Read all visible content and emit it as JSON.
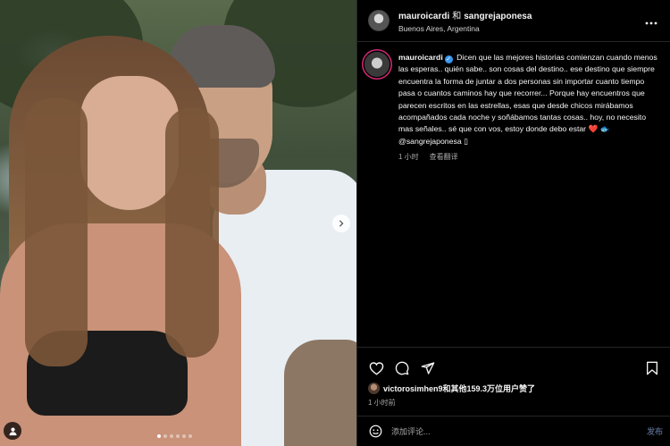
{
  "header": {
    "author": "mauroicardi",
    "conjunction": "和",
    "collaborator": "sangrejaponesa",
    "location": "Buenos Aires, Argentina",
    "more_icon": "more-horizontal-icon"
  },
  "caption": {
    "username": "mauroicardi",
    "verified_icon": "verified-badge-icon",
    "text": "Dicen que las mejores historias comienzan cuando menos las esperas.. quién sabe.. son cosas del destino.. ese destino que siempre encuentra la forma de juntar a dos personas sin importar cuanto tiempo pasa o cuantos caminos hay que recorrer... Porque hay encuentros que parecen escritos en las estrellas, esas que desde chicos mirábamos acompañados cada noche y soñábamos tantas cosas.. hoy, no necesito mas señales.. sé que con vos, estoy donde debo estar ❤️ 🐟",
    "mention": "@sangrejaponesa",
    "mention_suffix": " ▯",
    "time": "1 小时",
    "see_translation": "查看翻译"
  },
  "actions": {
    "like_icon": "heart-icon",
    "comment_icon": "comment-icon",
    "share_icon": "share-icon",
    "save_icon": "bookmark-icon"
  },
  "likes": {
    "first_user": "victorosimhen9",
    "rest": "和其他159.3万位用户赞了"
  },
  "post_time": "1 小时前",
  "comment": {
    "emoji_icon": "emoji-icon",
    "placeholder": "添加评论...",
    "post_label": "发布"
  },
  "carousel": {
    "slide_count": 6,
    "active_index": 0,
    "next_icon": "chevron-right-icon",
    "tag_icon": "user-tag-icon"
  },
  "colors": {
    "background": "#000000",
    "text": "#f5f5f5",
    "secondary_text": "#a8a8a8",
    "verified": "#3897f0",
    "like_heart": "#ed4956",
    "post_button_disabled": "#4b5b79"
  }
}
